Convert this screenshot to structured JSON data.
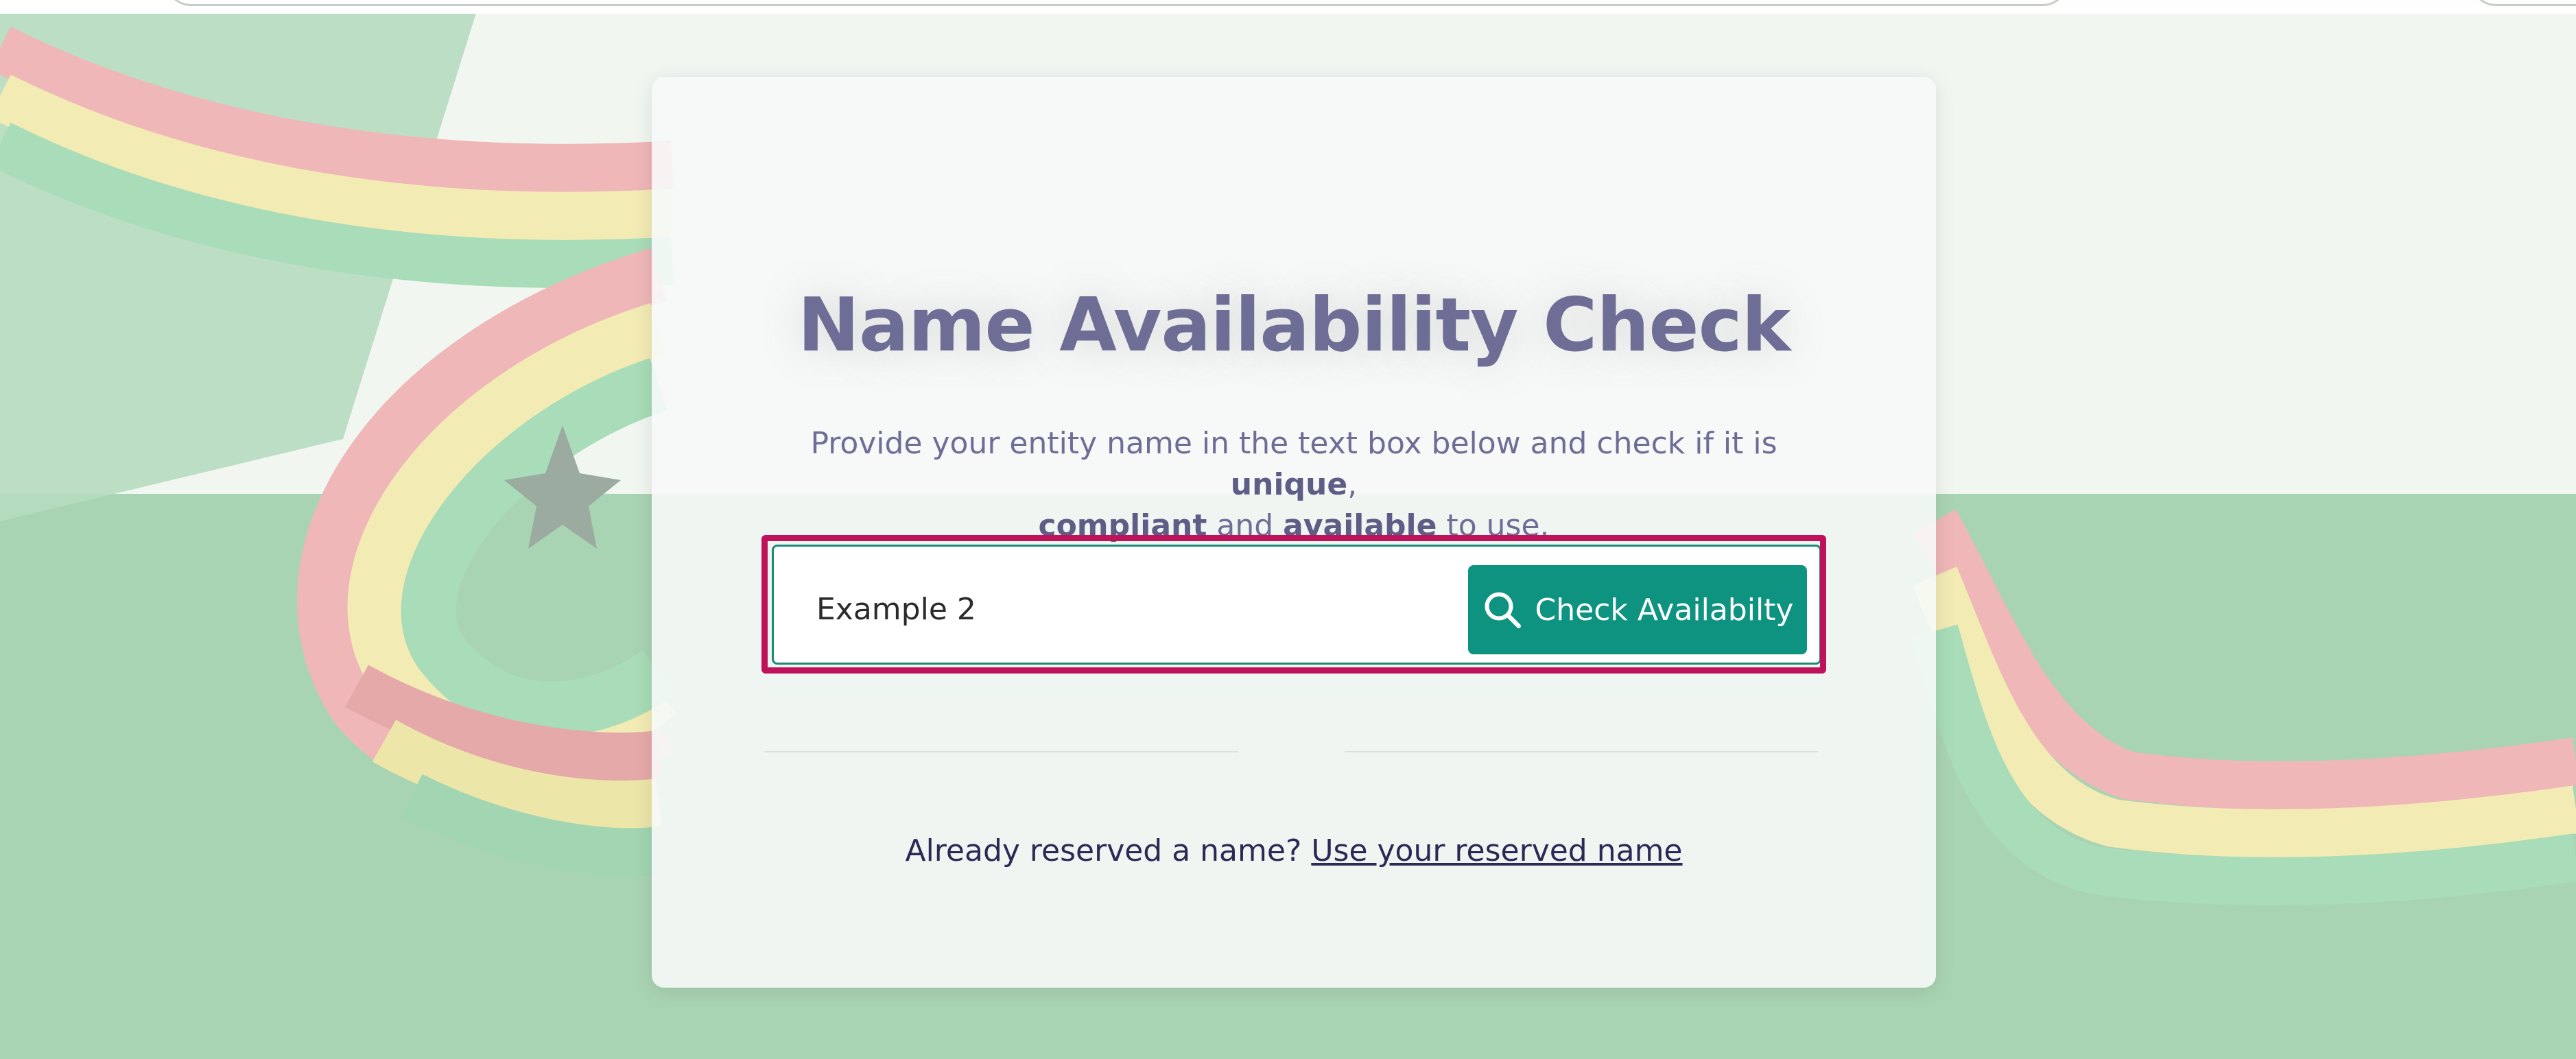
{
  "page": {
    "title": "Name Availability Check",
    "subtitle": {
      "part1": "Provide your entity name in the text box below and check if it is ",
      "bold1": "unique",
      "part2": ", ",
      "bold2": "compliant",
      "part3": " and ",
      "bold3": "available",
      "part4": " to use."
    }
  },
  "search": {
    "value": "Example 2",
    "button_label": "Check Availabilty",
    "button_icon": "search-icon"
  },
  "reserved": {
    "prompt": "Already reserved a name?",
    "link_label": "Use your reserved name"
  },
  "colors": {
    "accent": "#0d9380",
    "title": "#6e6d95",
    "highlight": "#c0125a",
    "link": "#2b2a55"
  }
}
